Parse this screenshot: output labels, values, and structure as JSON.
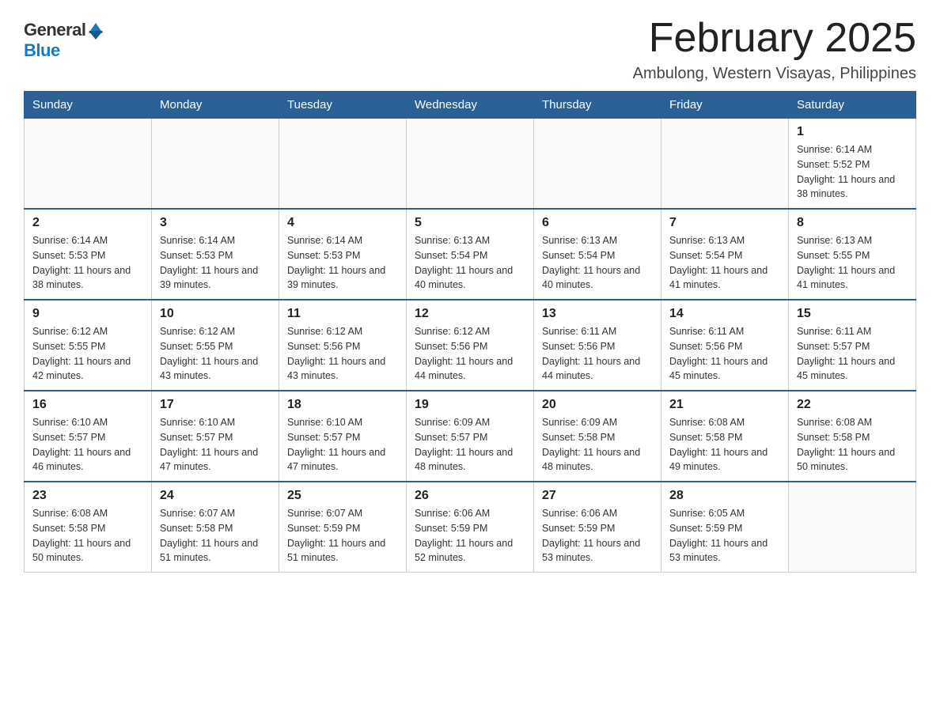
{
  "logo": {
    "general": "General",
    "blue": "Blue"
  },
  "header": {
    "title": "February 2025",
    "subtitle": "Ambulong, Western Visayas, Philippines"
  },
  "weekdays": [
    "Sunday",
    "Monday",
    "Tuesday",
    "Wednesday",
    "Thursday",
    "Friday",
    "Saturday"
  ],
  "weeks": [
    [
      {
        "day": "",
        "info": ""
      },
      {
        "day": "",
        "info": ""
      },
      {
        "day": "",
        "info": ""
      },
      {
        "day": "",
        "info": ""
      },
      {
        "day": "",
        "info": ""
      },
      {
        "day": "",
        "info": ""
      },
      {
        "day": "1",
        "info": "Sunrise: 6:14 AM\nSunset: 5:52 PM\nDaylight: 11 hours and 38 minutes."
      }
    ],
    [
      {
        "day": "2",
        "info": "Sunrise: 6:14 AM\nSunset: 5:53 PM\nDaylight: 11 hours and 38 minutes."
      },
      {
        "day": "3",
        "info": "Sunrise: 6:14 AM\nSunset: 5:53 PM\nDaylight: 11 hours and 39 minutes."
      },
      {
        "day": "4",
        "info": "Sunrise: 6:14 AM\nSunset: 5:53 PM\nDaylight: 11 hours and 39 minutes."
      },
      {
        "day": "5",
        "info": "Sunrise: 6:13 AM\nSunset: 5:54 PM\nDaylight: 11 hours and 40 minutes."
      },
      {
        "day": "6",
        "info": "Sunrise: 6:13 AM\nSunset: 5:54 PM\nDaylight: 11 hours and 40 minutes."
      },
      {
        "day": "7",
        "info": "Sunrise: 6:13 AM\nSunset: 5:54 PM\nDaylight: 11 hours and 41 minutes."
      },
      {
        "day": "8",
        "info": "Sunrise: 6:13 AM\nSunset: 5:55 PM\nDaylight: 11 hours and 41 minutes."
      }
    ],
    [
      {
        "day": "9",
        "info": "Sunrise: 6:12 AM\nSunset: 5:55 PM\nDaylight: 11 hours and 42 minutes."
      },
      {
        "day": "10",
        "info": "Sunrise: 6:12 AM\nSunset: 5:55 PM\nDaylight: 11 hours and 43 minutes."
      },
      {
        "day": "11",
        "info": "Sunrise: 6:12 AM\nSunset: 5:56 PM\nDaylight: 11 hours and 43 minutes."
      },
      {
        "day": "12",
        "info": "Sunrise: 6:12 AM\nSunset: 5:56 PM\nDaylight: 11 hours and 44 minutes."
      },
      {
        "day": "13",
        "info": "Sunrise: 6:11 AM\nSunset: 5:56 PM\nDaylight: 11 hours and 44 minutes."
      },
      {
        "day": "14",
        "info": "Sunrise: 6:11 AM\nSunset: 5:56 PM\nDaylight: 11 hours and 45 minutes."
      },
      {
        "day": "15",
        "info": "Sunrise: 6:11 AM\nSunset: 5:57 PM\nDaylight: 11 hours and 45 minutes."
      }
    ],
    [
      {
        "day": "16",
        "info": "Sunrise: 6:10 AM\nSunset: 5:57 PM\nDaylight: 11 hours and 46 minutes."
      },
      {
        "day": "17",
        "info": "Sunrise: 6:10 AM\nSunset: 5:57 PM\nDaylight: 11 hours and 47 minutes."
      },
      {
        "day": "18",
        "info": "Sunrise: 6:10 AM\nSunset: 5:57 PM\nDaylight: 11 hours and 47 minutes."
      },
      {
        "day": "19",
        "info": "Sunrise: 6:09 AM\nSunset: 5:57 PM\nDaylight: 11 hours and 48 minutes."
      },
      {
        "day": "20",
        "info": "Sunrise: 6:09 AM\nSunset: 5:58 PM\nDaylight: 11 hours and 48 minutes."
      },
      {
        "day": "21",
        "info": "Sunrise: 6:08 AM\nSunset: 5:58 PM\nDaylight: 11 hours and 49 minutes."
      },
      {
        "day": "22",
        "info": "Sunrise: 6:08 AM\nSunset: 5:58 PM\nDaylight: 11 hours and 50 minutes."
      }
    ],
    [
      {
        "day": "23",
        "info": "Sunrise: 6:08 AM\nSunset: 5:58 PM\nDaylight: 11 hours and 50 minutes."
      },
      {
        "day": "24",
        "info": "Sunrise: 6:07 AM\nSunset: 5:58 PM\nDaylight: 11 hours and 51 minutes."
      },
      {
        "day": "25",
        "info": "Sunrise: 6:07 AM\nSunset: 5:59 PM\nDaylight: 11 hours and 51 minutes."
      },
      {
        "day": "26",
        "info": "Sunrise: 6:06 AM\nSunset: 5:59 PM\nDaylight: 11 hours and 52 minutes."
      },
      {
        "day": "27",
        "info": "Sunrise: 6:06 AM\nSunset: 5:59 PM\nDaylight: 11 hours and 53 minutes."
      },
      {
        "day": "28",
        "info": "Sunrise: 6:05 AM\nSunset: 5:59 PM\nDaylight: 11 hours and 53 minutes."
      },
      {
        "day": "",
        "info": ""
      }
    ]
  ]
}
